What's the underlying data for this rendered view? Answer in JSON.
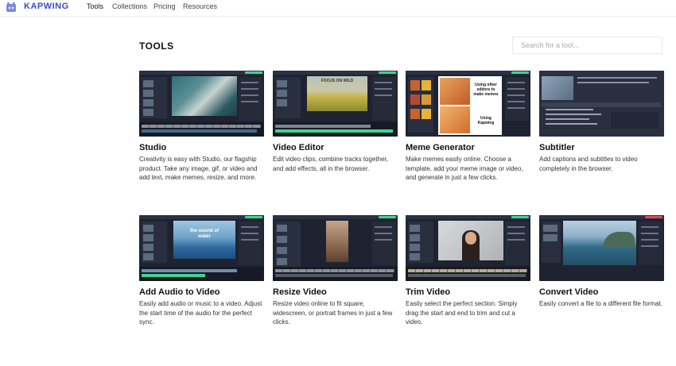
{
  "header": {
    "brand": "KAPWING",
    "logo_icon": "kapwing-logo-icon",
    "nav": [
      {
        "label": "Tools",
        "active": true
      },
      {
        "label": "Collections",
        "active": false
      },
      {
        "label": "Pricing",
        "active": false
      },
      {
        "label": "Resources",
        "active": false
      }
    ]
  },
  "main": {
    "title": "TOOLS",
    "search_placeholder": "Search for a tool..."
  },
  "tools": [
    {
      "name": "Studio",
      "description": "Creativity is easy with Studio, our flagship product. Take any image, gif, or video and add text, make memes, resize, and more."
    },
    {
      "name": "Video Editor",
      "description": "Edit video clips, combine tracks together, and add effects, all in the browser.",
      "thumb_text": "FOCUS ON WILD"
    },
    {
      "name": "Meme Generator",
      "description": "Make memes easily online. Choose a template, add your meme image or video, and generate in just a few clicks.",
      "thumb_text_top": "Using other editors to make memes",
      "thumb_text_bottom": "Using Kapwing"
    },
    {
      "name": "Subtitler",
      "description": "Add captions and subtitles to video completely in the browser."
    },
    {
      "name": "Add Audio to Video",
      "description": "Easily add audio or music to a video. Adjust the start time of the audio for the perfect sync.",
      "thumb_text": "the sound of water"
    },
    {
      "name": "Resize Video",
      "description": "Resize video online to fit square, widescreen, or portrait frames in just a few clicks."
    },
    {
      "name": "Trim Video",
      "description": "Easily select the perfect section. Simply drag the start and end to trim and cut a video."
    },
    {
      "name": "Convert Video",
      "description": "Easily convert a file to a different file format."
    }
  ],
  "colors": {
    "brand": "#3b4bc8",
    "accent_green": "#3dd68c",
    "editor_bg": "#1f2331"
  }
}
